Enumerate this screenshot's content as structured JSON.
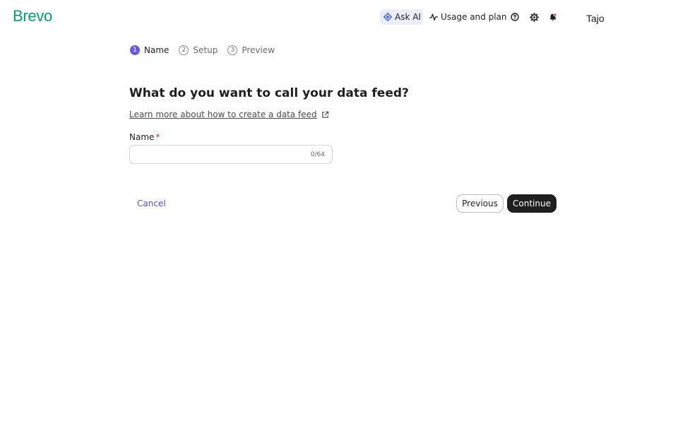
{
  "header": {
    "logo": "Brevo",
    "ask_ai": "Ask AI",
    "usage": "Usage and plan",
    "user": "Tajo",
    "icons": [
      "sparkle-icon",
      "activity-icon",
      "help-icon",
      "gear-icon",
      "bell-icon"
    ]
  },
  "stepper": {
    "steps": [
      {
        "num": "1",
        "label": "Name",
        "state": "active"
      },
      {
        "num": "2",
        "label": "Setup",
        "state": "inactive"
      },
      {
        "num": "3",
        "label": "Preview",
        "state": "inactive"
      }
    ]
  },
  "form": {
    "title": "What do you want to call your data feed?",
    "learn_more": "Learn more about how to create a data feed",
    "name_label": "Name",
    "required_mark": "*",
    "name_value": "",
    "counter": "0/64"
  },
  "actions": {
    "cancel": "Cancel",
    "previous": "Previous",
    "continue": "Continue"
  },
  "colors": {
    "brand": "#0b996e",
    "accent": "#6b5bd6",
    "primary_button": "#1f1f1f",
    "required": "#d9342b"
  }
}
